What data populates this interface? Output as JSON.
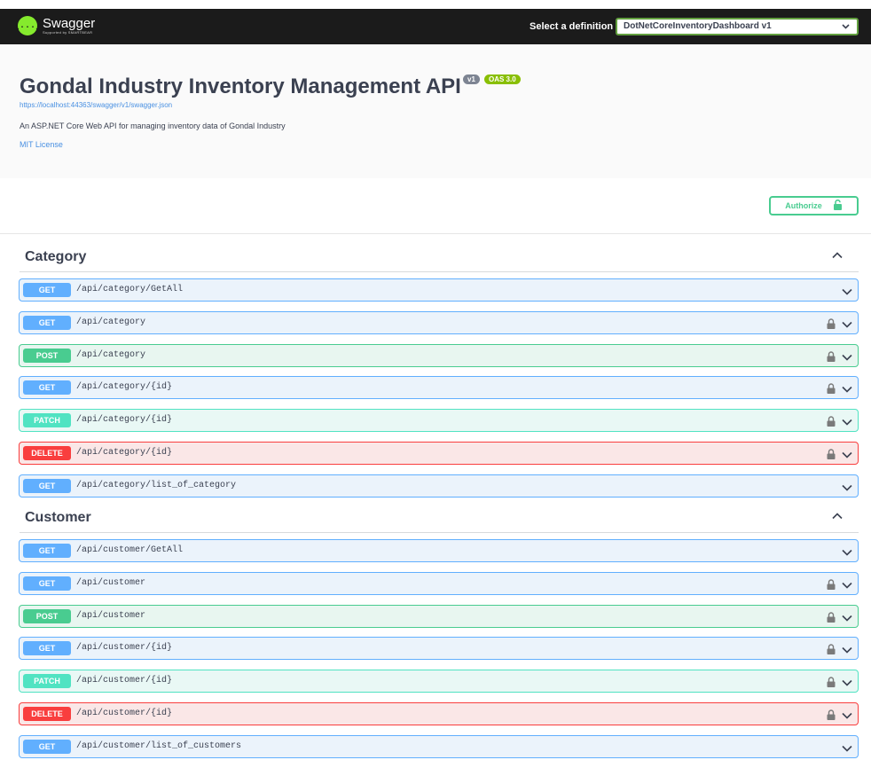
{
  "topbar": {
    "logo_name": "Swagger",
    "logo_sub": "Supported by SMARTBEAR",
    "logo_glyph": "{...}",
    "definition_label": "Select a definition",
    "definition_value": "DotNetCoreInventoryDashboard v1"
  },
  "info": {
    "title": "Gondal Industry Inventory Management API",
    "version_badge": "v1",
    "oas_badge": "OAS 3.0",
    "spec_url": "https://localhost:44363/swagger/v1/swagger.json",
    "description": "An ASP.NET Core Web API for managing inventory data of Gondal Industry",
    "license": "MIT License"
  },
  "authorize": {
    "label": "Authorize"
  },
  "tags": [
    {
      "name": "Category",
      "operations": [
        {
          "method": "GET",
          "path": "/api/category/GetAll",
          "locked": false
        },
        {
          "method": "GET",
          "path": "/api/category",
          "locked": true
        },
        {
          "method": "POST",
          "path": "/api/category",
          "locked": true
        },
        {
          "method": "GET",
          "path": "/api/category/{id}",
          "locked": true
        },
        {
          "method": "PATCH",
          "path": "/api/category/{id}",
          "locked": true
        },
        {
          "method": "DELETE",
          "path": "/api/category/{id}",
          "locked": true
        },
        {
          "method": "GET",
          "path": "/api/category/list_of_category",
          "locked": false
        }
      ]
    },
    {
      "name": "Customer",
      "operations": [
        {
          "method": "GET",
          "path": "/api/customer/GetAll",
          "locked": false
        },
        {
          "method": "GET",
          "path": "/api/customer",
          "locked": true
        },
        {
          "method": "POST",
          "path": "/api/customer",
          "locked": true
        },
        {
          "method": "GET",
          "path": "/api/customer/{id}",
          "locked": true
        },
        {
          "method": "PATCH",
          "path": "/api/customer/{id}",
          "locked": true
        },
        {
          "method": "DELETE",
          "path": "/api/customer/{id}",
          "locked": true
        },
        {
          "method": "GET",
          "path": "/api/customer/list_of_customers",
          "locked": false
        }
      ]
    }
  ],
  "colors": {
    "get": "#61affe",
    "post": "#49cc90",
    "patch": "#50e3c2",
    "delete": "#f93e3e",
    "topbar": "#1b1b1b",
    "logo": "#85ea2d"
  },
  "icons": {
    "tag_toggle": "chevron-up-icon",
    "op_expand": "chevron-down-icon",
    "op_lock": "lock-icon",
    "authorize": "unlock-icon"
  }
}
